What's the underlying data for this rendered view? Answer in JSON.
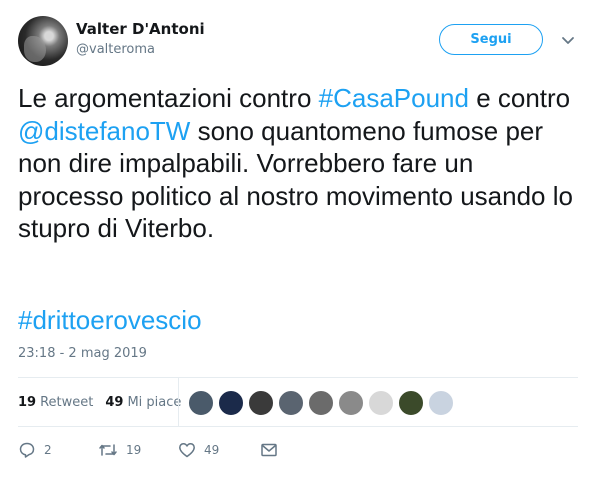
{
  "header": {
    "display_name": "Valter D'Antoni",
    "handle": "@valteroma",
    "follow_label": "Segui",
    "avatar_icon": "avatar-photo",
    "menu_icon": "chevron-down-icon"
  },
  "tweet": {
    "segments": [
      "Le argomentazioni contro ",
      "#CasaPound",
      " e contro ",
      "@distefanoTW",
      " sono quantomeno fumose per non dire impalpabili. Vorrebbero fare un processo politico al nostro movimento usando lo stupro di Viterbo."
    ],
    "hashtag": "#drittoerovescio",
    "timestamp": "23:18 - 2 mag 2019"
  },
  "stats": {
    "retweets_count": "19",
    "retweets_label": "Retweet",
    "likes_count": "49",
    "likes_label": "Mi piace"
  },
  "likers": [
    {
      "color": "#4a5a6a"
    },
    {
      "color": "#1b2a4a"
    },
    {
      "color": "#3a3a3a"
    },
    {
      "color": "#5a6470"
    },
    {
      "color": "#6b6b6b"
    },
    {
      "color": "#8a8a8a"
    },
    {
      "color": "#d8d8d8"
    },
    {
      "color": "#3b4a2a"
    },
    {
      "color": "#c9d3e0"
    }
  ],
  "actions": {
    "reply_count": "2",
    "retweet_count": "19",
    "like_count": "49"
  },
  "colors": {
    "accent": "#1da1f2",
    "muted": "#657786",
    "border": "#e6ecf0",
    "text": "#14171a"
  }
}
